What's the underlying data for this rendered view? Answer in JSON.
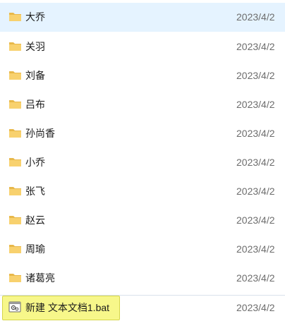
{
  "files": [
    {
      "name": "大乔",
      "date": "2023/4/2",
      "type": "folder",
      "hover": true
    },
    {
      "name": "关羽",
      "date": "2023/4/2",
      "type": "folder"
    },
    {
      "name": "刘备",
      "date": "2023/4/2",
      "type": "folder"
    },
    {
      "name": "吕布",
      "date": "2023/4/2",
      "type": "folder"
    },
    {
      "name": "孙尚香",
      "date": "2023/4/2",
      "type": "folder"
    },
    {
      "name": "小乔",
      "date": "2023/4/2",
      "type": "folder"
    },
    {
      "name": "张飞",
      "date": "2023/4/2",
      "type": "folder"
    },
    {
      "name": "赵云",
      "date": "2023/4/2",
      "type": "folder"
    },
    {
      "name": "周瑜",
      "date": "2023/4/2",
      "type": "folder"
    },
    {
      "name": "诸葛亮",
      "date": "2023/4/2",
      "type": "folder"
    },
    {
      "name": "新建 文本文档1.bat",
      "date": "2023/4/2",
      "type": "bat-file",
      "highlighted": true
    }
  ],
  "colors": {
    "hover_bg": "#e5f3ff",
    "highlight_bg": "#f7f78a",
    "folder_yellow": "#f8d16e"
  }
}
